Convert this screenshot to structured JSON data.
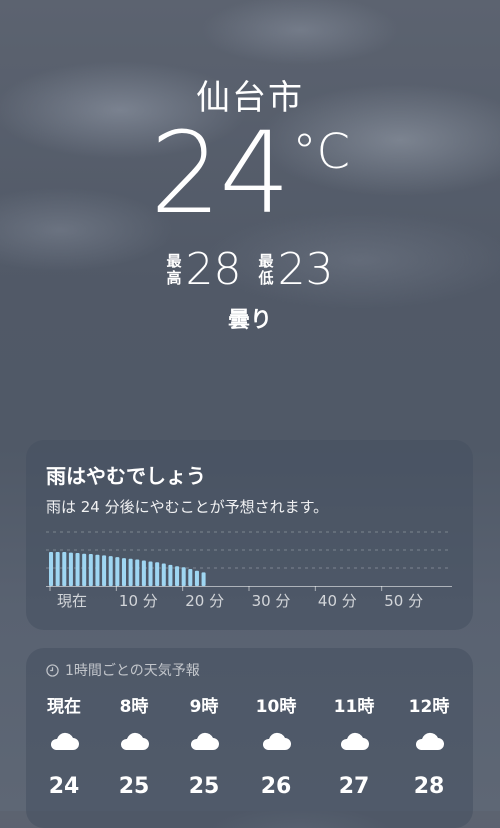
{
  "location": {
    "city": "仙台市",
    "temperature": "24",
    "unit": "°C",
    "high_label_1": "最",
    "high_label_2": "高",
    "high": "28",
    "low_label_1": "最",
    "low_label_2": "低",
    "low": "23",
    "condition": "曇り"
  },
  "rain": {
    "title": "雨はやむでしょう",
    "description": "雨は 24 分後にやむことが予想されます。",
    "ticks": [
      "現在",
      "10 分",
      "20 分",
      "30 分",
      "40 分",
      "50 分"
    ],
    "bar_levels": [
      1.0,
      1.0,
      1.0,
      0.98,
      0.97,
      0.95,
      0.94,
      0.92,
      0.9,
      0.88,
      0.85,
      0.82,
      0.8,
      0.78,
      0.75,
      0.72,
      0.7,
      0.66,
      0.62,
      0.58,
      0.55,
      0.5,
      0.45,
      0.4
    ],
    "bar_color": "#9fd6f2"
  },
  "hourly": {
    "title": "1時間ごとの天気予報",
    "title_icon": "clock-icon",
    "hours": [
      {
        "label": "現在",
        "icon": "cloud-icon",
        "temp": "24"
      },
      {
        "label": "8時",
        "icon": "cloud-icon",
        "temp": "25"
      },
      {
        "label": "9時",
        "icon": "cloud-icon",
        "temp": "25"
      },
      {
        "label": "10時",
        "icon": "cloud-icon",
        "temp": "26"
      },
      {
        "label": "11時",
        "icon": "cloud-icon",
        "temp": "27"
      },
      {
        "label": "12時",
        "icon": "cloud-icon",
        "temp": "28"
      }
    ]
  }
}
